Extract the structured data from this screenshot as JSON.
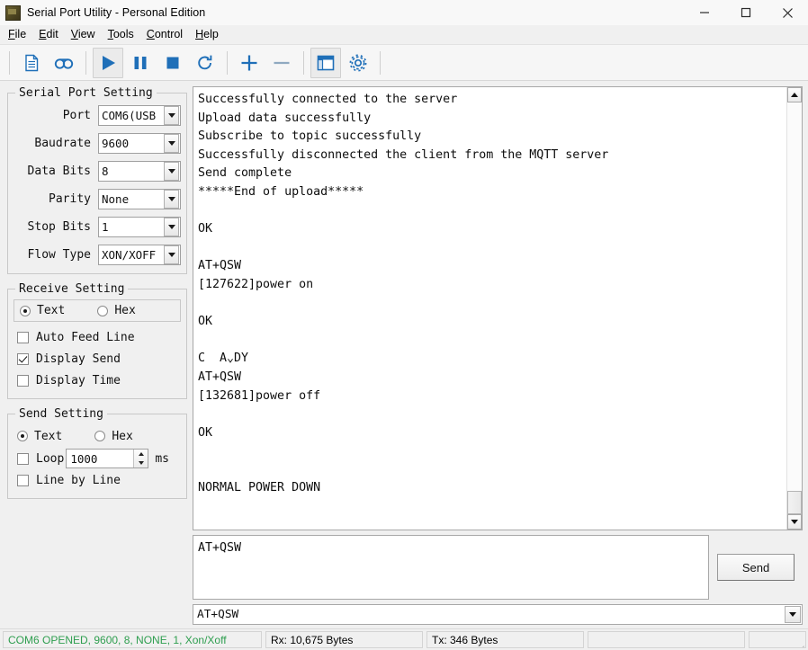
{
  "window": {
    "title": "Serial Port Utility - Personal Edition",
    "app_icon": "app-icon",
    "minimize_label": "minimize-icon",
    "maximize_label": "maximize-icon",
    "close_label": "close-icon"
  },
  "menubar": {
    "items": [
      {
        "label": "File",
        "mnemonic": "F"
      },
      {
        "label": "Edit",
        "mnemonic": "E"
      },
      {
        "label": "View",
        "mnemonic": "V"
      },
      {
        "label": "Tools",
        "mnemonic": "T"
      },
      {
        "label": "Control",
        "mnemonic": "C"
      },
      {
        "label": "Help",
        "mnemonic": "H"
      }
    ]
  },
  "toolbar": {
    "items": [
      {
        "name": "new-file-icon",
        "selected": false
      },
      {
        "name": "tape-record-icon",
        "selected": false
      },
      {
        "name": "play-icon",
        "selected": true
      },
      {
        "name": "pause-icon",
        "selected": false
      },
      {
        "name": "stop-icon",
        "selected": false
      },
      {
        "name": "refresh-icon",
        "selected": false
      },
      {
        "name": "plus-icon",
        "selected": false
      },
      {
        "name": "minus-icon",
        "selected": false
      },
      {
        "name": "window-layout-icon",
        "selected": true
      },
      {
        "name": "gear-settings-icon",
        "selected": false
      }
    ]
  },
  "serial_port_setting": {
    "legend": "Serial Port Setting",
    "fields": [
      {
        "label": "Port",
        "value": "COM6(USB"
      },
      {
        "label": "Baudrate",
        "value": "9600"
      },
      {
        "label": "Data Bits",
        "value": "8"
      },
      {
        "label": "Parity",
        "value": "None"
      },
      {
        "label": "Stop Bits",
        "value": "1"
      },
      {
        "label": "Flow Type",
        "value": "XON/XOFF"
      }
    ]
  },
  "receive_setting": {
    "legend": "Receive Setting",
    "format_text": "Text",
    "format_hex": "Hex",
    "format_selected": "Text",
    "checkboxes": [
      {
        "label": "Auto Feed Line",
        "checked": false
      },
      {
        "label": "Display Send",
        "checked": true
      },
      {
        "label": "Display Time",
        "checked": false
      }
    ]
  },
  "send_setting": {
    "legend": "Send Setting",
    "format_text": "Text",
    "format_hex": "Hex",
    "format_selected": "Text",
    "loop_label": "Loop",
    "loop_checked": false,
    "loop_value": "1000",
    "loop_unit": "ms",
    "line_by_line_label": "Line by Line",
    "line_by_line_checked": false
  },
  "terminal": {
    "content": "Successfully connected to the server\nUpload data successfully\nSubscribe to topic successfully\nSuccessfully disconnected the client from the MQTT server\nSend complete\n*****End of upload*****\n\nOK\n\nAT+QSW\n[127622]power on\n\nOK\n\nC  A⌄DY\nAT+QSW\n[132681]power off\n\nOK\n\n\nNORMAL POWER DOWN",
    "scrollbar": "vertical-scrollbar"
  },
  "send_area": {
    "input_value": "AT+QSW",
    "send_label": "Send",
    "history_value": "AT+QSW"
  },
  "statusbar": {
    "connection": "COM6 OPENED, 9600, 8, NONE, 1, Xon/Xoff",
    "connection_color": "#2e9e4f",
    "rx": "Rx: 10,675 Bytes",
    "tx": "Tx: 346 Bytes",
    "extra1": "",
    "extra2": ""
  }
}
